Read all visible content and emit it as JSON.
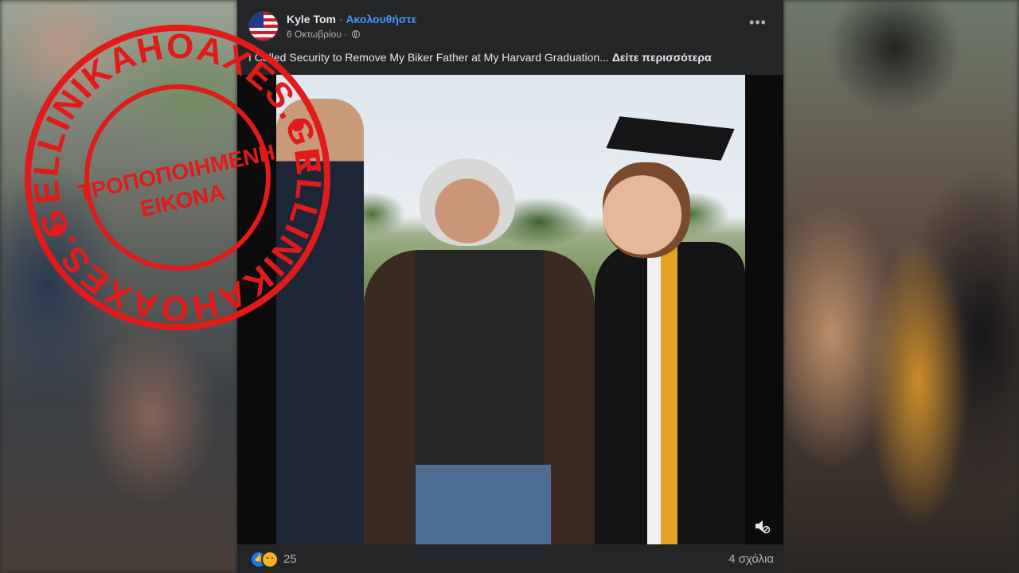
{
  "post": {
    "author": "Kyle Tom",
    "separator": "·",
    "follow_label": "Ακολουθήστε",
    "date": "6 Οκτωβρίου",
    "meta_separator": "·",
    "text": "I Called Security to Remove My Biker Father at My Harvard Graduation...",
    "see_more": "Δείτε περισσότερα",
    "more_icon": "more-horizontal-icon",
    "audience_icon": "globe-icon"
  },
  "footer": {
    "reactions": [
      "like",
      "sad"
    ],
    "reaction_count": "25",
    "comments": "4 σχόλια"
  },
  "stamp": {
    "outer_text": "ELLINIKAHOAXES.GR",
    "center_line1": "ΤΡΟΠΟΠΟΙΗΜΕΝΗ",
    "center_line2": "ΕΙΚΟΝΑ",
    "color": "#e11a1a"
  },
  "colors": {
    "card": "#242526",
    "link": "#4599ff",
    "like": "#1877f2",
    "sad": "#f7b125"
  }
}
